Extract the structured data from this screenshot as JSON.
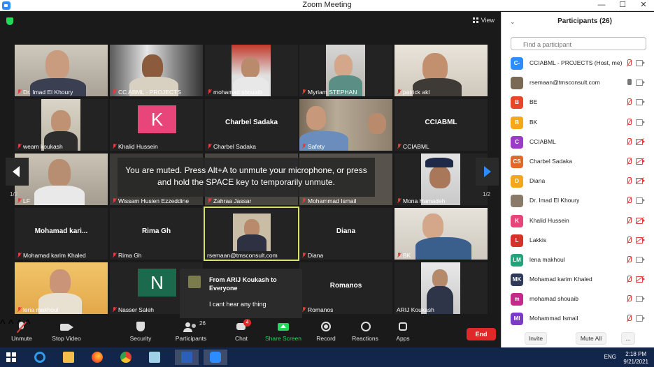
{
  "window": {
    "title": "Zoom Meeting",
    "controls": [
      "—",
      "☐",
      "✕"
    ]
  },
  "video": {
    "view_label": "View",
    "page_left": "1/2",
    "page_right": "1/2",
    "muted_message": "You are muted. Press Alt+A to unmute your microphone, or press and hold the SPACE key to temporarily unmute.",
    "tiles": [
      {
        "name": "Dr. Imad El Khoury"
      },
      {
        "name": "CC ABML - PROJECTS"
      },
      {
        "name": "mohamad shouaib"
      },
      {
        "name": "Myriam STEPHAN"
      },
      {
        "name": "patrick akl"
      },
      {
        "name": "weam koukash"
      },
      {
        "name": "Khalid Hussein",
        "initial": "K",
        "initial_color": "#e8457a"
      },
      {
        "name": "Charbel Sadaka",
        "center": "Charbel Sadaka"
      },
      {
        "name": "Safety"
      },
      {
        "name": "CCIABML",
        "center": "CCIABML"
      },
      {
        "name": "LF"
      },
      {
        "name": "Wissam Husien Ezzeddine"
      },
      {
        "name": "Zahraa Jassar"
      },
      {
        "name": "Mohammad Ismail"
      },
      {
        "name": "Mona Hamadeh"
      },
      {
        "name": "Mohamad karim Khaled",
        "center": "Mohamad  kari..."
      },
      {
        "name": "Rima Gh",
        "center": "Rima Gh"
      },
      {
        "name": "rsemaan@tmsconsult.com"
      },
      {
        "name": "Diana",
        "center": "Diana"
      },
      {
        "name": "BK"
      },
      {
        "name": "lena makhoul"
      },
      {
        "name": "Nasser Saleh",
        "initial": "N",
        "initial_color": "#1c6a4e"
      },
      {
        "name": "Romanos",
        "center": "Romanos"
      },
      {
        "name": "ARIJ Koukash"
      }
    ],
    "chat_popup": {
      "from": "From ARIJ Koukash to Everyone",
      "message": "I cant hear any thing"
    }
  },
  "toolbar": {
    "unmute": "Unmute",
    "stop_video": "Stop Video",
    "security": "Security",
    "participants": "Participants",
    "participants_count": "26",
    "chat": "Chat",
    "chat_badge": "4",
    "share_screen": "Share Screen",
    "record": "Record",
    "reactions": "Reactions",
    "apps": "Apps",
    "end": "End",
    "share_color": "#23d959",
    "end_color": "#e02828"
  },
  "panel": {
    "title": "Participants (26)",
    "search_placeholder": "Find a participant",
    "participants": [
      {
        "initials": "C-",
        "color": "#2d8cff",
        "name": "CCIABML - PROJECTS (Host, me)",
        "mic_on": false,
        "video_on": true
      },
      {
        "initials": "",
        "color": "#7a6a55",
        "name": "rsemaan@tmsconsult.com",
        "mic_on": true,
        "video_on": true
      },
      {
        "initials": "B",
        "color": "#e8452a",
        "name": "BE",
        "mic_on": false,
        "video_on": true
      },
      {
        "initials": "B",
        "color": "#f4a71b",
        "name": "BK",
        "mic_on": false,
        "video_on": true
      },
      {
        "initials": "C",
        "color": "#9b3cc7",
        "name": "CCIABML",
        "mic_on": false,
        "video_on": false
      },
      {
        "initials": "CS",
        "color": "#e0692a",
        "name": "Charbel Sadaka",
        "mic_on": false,
        "video_on": false
      },
      {
        "initials": "D",
        "color": "#f4a71b",
        "name": "Diana",
        "mic_on": false,
        "video_on": false
      },
      {
        "initials": "",
        "color": "#8a7a6a",
        "name": "Dr. Imad El Khoury",
        "mic_on": false,
        "video_on": true
      },
      {
        "initials": "K",
        "color": "#e8457a",
        "name": "Khalid Hussein",
        "mic_on": false,
        "video_on": false
      },
      {
        "initials": "L",
        "color": "#d6322a",
        "name": "Lakkis",
        "mic_on": false,
        "video_on": false
      },
      {
        "initials": "LM",
        "color": "#24a37a",
        "name": "lena makhoul",
        "mic_on": false,
        "video_on": true
      },
      {
        "initials": "MK",
        "color": "#2e3a57",
        "name": "Mohamad karim Khaled",
        "mic_on": false,
        "video_on": false
      },
      {
        "initials": "m",
        "color": "#c42a8a",
        "name": "mohamad shouaib",
        "mic_on": false,
        "video_on": true
      },
      {
        "initials": "MI",
        "color": "#7a3cc7",
        "name": "Mohammad Ismail",
        "mic_on": false,
        "video_on": true
      }
    ],
    "invite": "Invite",
    "mute_all": "Mute All",
    "more": "..."
  },
  "taskbar": {
    "lang": "ENG",
    "time": "2:18 PM",
    "date": "9/21/2021"
  }
}
